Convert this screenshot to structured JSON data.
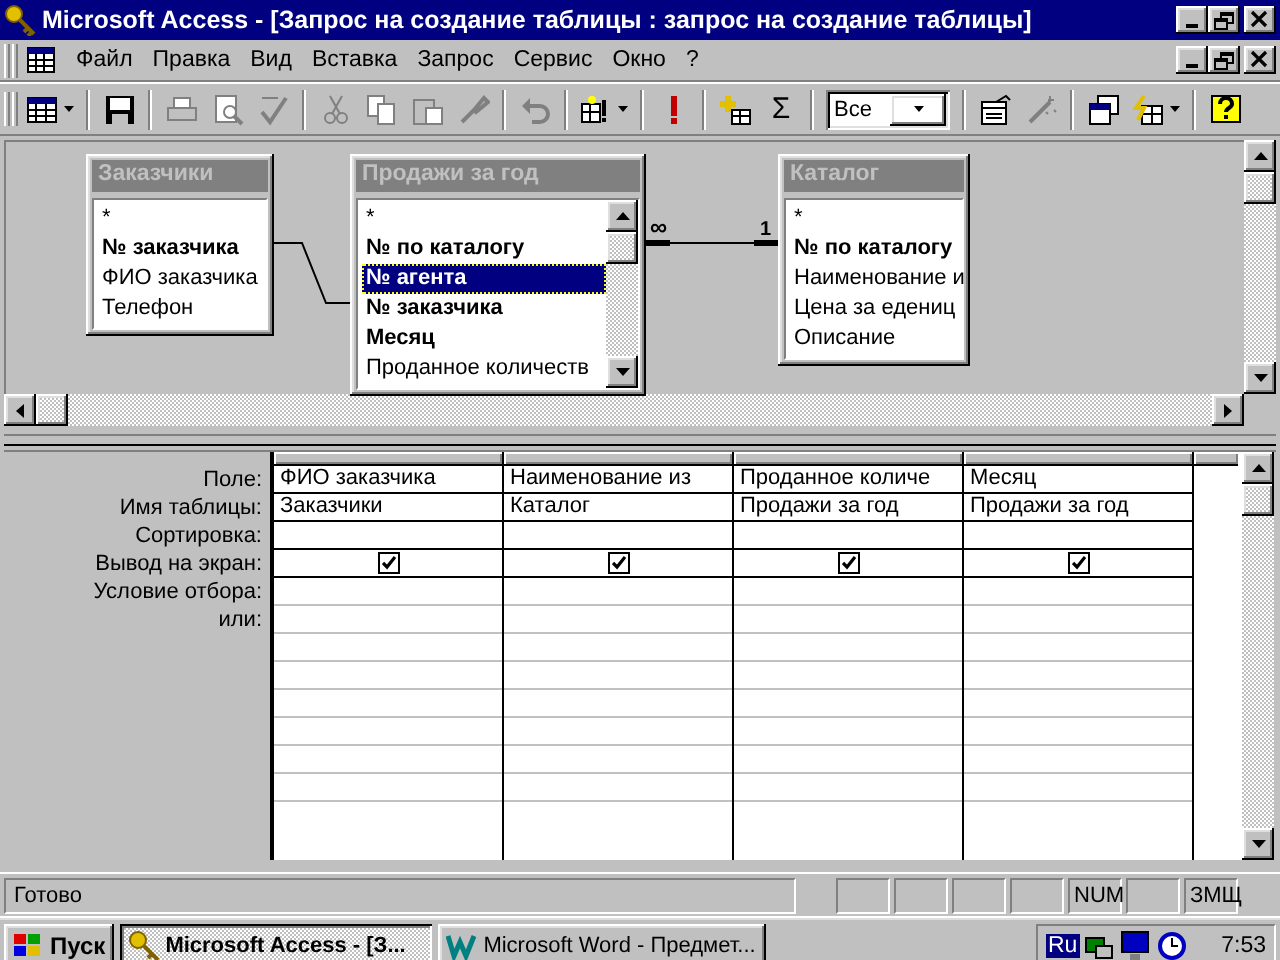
{
  "window": {
    "title": "Microsoft Access - [Запрос на создание таблицы : запрос на создание таблицы]"
  },
  "menu": {
    "items": [
      {
        "label": "Файл"
      },
      {
        "label": "Правка"
      },
      {
        "label": "Вид"
      },
      {
        "label": "Вставка"
      },
      {
        "label": "Запрос"
      },
      {
        "label": "Сервис"
      },
      {
        "label": "Окно"
      },
      {
        "label": "?"
      }
    ]
  },
  "toolbar": {
    "items": [
      {
        "kind": "button",
        "disabled": false
      },
      {
        "kind": "separator"
      },
      {
        "kind": "button",
        "disabled": false
      },
      {
        "kind": "separator"
      },
      {
        "kind": "button",
        "disabled": true
      },
      {
        "kind": "button",
        "disabled": true
      },
      {
        "kind": "button",
        "disabled": true
      },
      {
        "kind": "separator"
      },
      {
        "kind": "button",
        "disabled": true
      },
      {
        "kind": "button",
        "disabled": true
      },
      {
        "kind": "button",
        "disabled": true
      },
      {
        "kind": "button",
        "disabled": true
      },
      {
        "kind": "separator"
      },
      {
        "kind": "button",
        "disabled": true
      },
      {
        "kind": "separator"
      },
      {
        "kind": "button",
        "disabled": false
      },
      {
        "kind": "separator"
      },
      {
        "kind": "button",
        "disabled": false
      },
      {
        "kind": "separator"
      },
      {
        "kind": "button",
        "disabled": false
      },
      {
        "kind": "text",
        "label": "Σ"
      },
      {
        "kind": "separator"
      },
      {
        "kind": "combo",
        "value": "Все"
      },
      {
        "kind": "separator"
      },
      {
        "kind": "button",
        "disabled": false
      },
      {
        "kind": "button",
        "disabled": true
      },
      {
        "kind": "separator"
      },
      {
        "kind": "button",
        "disabled": false
      },
      {
        "kind": "button",
        "disabled": false
      },
      {
        "kind": "separator"
      },
      {
        "kind": "button",
        "disabled": false
      }
    ]
  },
  "tables": [
    {
      "title": "Заказчики",
      "has_scrollbar": false,
      "fields": [
        {
          "name": "*",
          "key": false,
          "selected": false
        },
        {
          "name": "№ заказчика",
          "key": true,
          "selected": false
        },
        {
          "name": "ФИО заказчика",
          "key": false,
          "selected": false
        },
        {
          "name": "Телефон",
          "key": false,
          "selected": false
        }
      ]
    },
    {
      "title": "Продажи за год",
      "has_scrollbar": true,
      "fields": [
        {
          "name": "*",
          "key": false,
          "selected": false
        },
        {
          "name": "№ по каталогу",
          "key": true,
          "selected": false
        },
        {
          "name": "№ агента",
          "key": true,
          "selected": true
        },
        {
          "name": "№ заказчика",
          "key": true,
          "selected": false
        },
        {
          "name": "Месяц",
          "key": true,
          "selected": false
        },
        {
          "name": "Проданное количеств",
          "key": false,
          "selected": false
        }
      ]
    },
    {
      "title": "Каталог",
      "has_scrollbar": false,
      "fields": [
        {
          "name": "*",
          "key": false,
          "selected": false
        },
        {
          "name": "№ по каталогу",
          "key": true,
          "selected": false
        },
        {
          "name": "Наименование и",
          "key": false,
          "selected": false
        },
        {
          "name": "Цена за едениц",
          "key": false,
          "selected": false
        },
        {
          "name": "Описание",
          "key": false,
          "selected": false
        }
      ]
    }
  ],
  "joins": [
    {
      "kind": "plain"
    },
    {
      "kind": "one_to_many",
      "many_label": "∞",
      "one_label": "1"
    }
  ],
  "grid": {
    "row_labels": [
      "Поле:",
      "Имя таблицы:",
      "Сортировка:",
      "Вывод на экран:",
      "Условие отбора:",
      "или:"
    ],
    "columns": [
      {
        "field": "ФИО заказчика",
        "table": "Заказчики",
        "show": true
      },
      {
        "field": "Наименование из",
        "table": "Каталог",
        "show": true
      },
      {
        "field": "Проданное количе",
        "table": "Продажи за год",
        "show": true
      },
      {
        "field": "Месяц",
        "table": "Продажи за год",
        "show": true
      }
    ]
  },
  "status_bar": {
    "text": "Готово",
    "indicators": [
      {
        "kind": "blank"
      },
      {
        "kind": "blank"
      },
      {
        "kind": "blank"
      },
      {
        "kind": "blank"
      },
      {
        "kind": "label",
        "label": "NUM"
      },
      {
        "kind": "blank"
      },
      {
        "kind": "label",
        "label": "ЗМЩ"
      }
    ]
  },
  "taskbar": {
    "start": "Пуск",
    "tasks": [
      {
        "label": "Microsoft Access - [З...",
        "selected": true
      },
      {
        "label": "Microsoft Word - Предмет...",
        "selected": false
      }
    ],
    "tray": {
      "language": "Ru",
      "clock": "7:53"
    }
  }
}
